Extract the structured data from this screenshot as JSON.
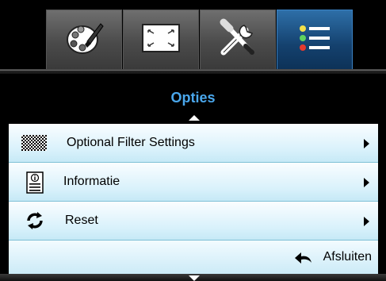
{
  "tabs": [
    {
      "icon": "palette-icon"
    },
    {
      "icon": "screen-resize-icon"
    },
    {
      "icon": "tools-icon"
    },
    {
      "icon": "list-menu-icon",
      "active": true
    }
  ],
  "header": {
    "title": "Opties"
  },
  "menu": {
    "items": [
      {
        "label": "Optional Filter Settings",
        "icon": "filter-pattern-icon"
      },
      {
        "label": "Informatie",
        "icon": "info-document-icon"
      },
      {
        "label": "Reset",
        "icon": "reset-arrows-icon"
      }
    ]
  },
  "footer": {
    "exit_label": "Afsluiten",
    "exit_icon": "back-arrow-icon"
  },
  "colors": {
    "title": "#4aa7ec",
    "active_tab": "#1b4f84",
    "row_bg": "#d8f1fb"
  }
}
